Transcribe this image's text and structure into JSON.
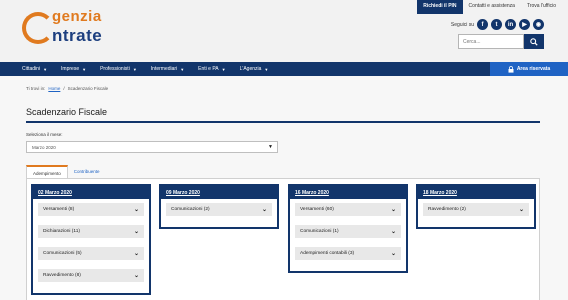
{
  "logo": {
    "line1": "genzia",
    "line2": "ntrate"
  },
  "top_links": [
    "Richiedi il PIN",
    "Contatti e assistenza",
    "Trova l'ufficio"
  ],
  "follow_label": "Seguici su",
  "social": [
    {
      "icon": "facebook-icon",
      "glyph": "f"
    },
    {
      "icon": "twitter-icon",
      "glyph": "t"
    },
    {
      "icon": "linkedin-icon",
      "glyph": "in"
    },
    {
      "icon": "youtube-icon",
      "glyph": "▶"
    },
    {
      "icon": "rss-icon",
      "glyph": "◉"
    }
  ],
  "search": {
    "placeholder": "Cerca..."
  },
  "nav": [
    "Cittadini",
    "Imprese",
    "Professionisti",
    "Intermediari",
    "Enti e PA",
    "L'Agenzia"
  ],
  "reserved": "Area riservata",
  "breadcrumb": {
    "prefix": "Ti trovi in:",
    "home": "Home",
    "sep": "/",
    "current": "Scadenzario Fiscale"
  },
  "page_title": "Scadenzario Fiscale",
  "select": {
    "label": "Seleziona il mese:",
    "value": "Marzo 2020"
  },
  "tabs": [
    "Adempimento",
    "Contribuente"
  ],
  "columns": [
    {
      "date": "02 Marzo 2020",
      "items": [
        "Versamenti (8)",
        "Dichiarazioni (11)",
        "Comunicazioni (5)",
        "Ravvedimento (8)"
      ]
    },
    {
      "date": "09 Marzo 2020",
      "items": [
        "Comunicazioni (2)"
      ]
    },
    {
      "date": "16 Marzo 2020",
      "items": [
        "Versamenti (60)",
        "Comunicazioni (1)",
        "Adempimenti contabili (3)"
      ]
    },
    {
      "date": "18 Marzo 2020",
      "items": [
        "Ravvedimento (2)"
      ]
    }
  ],
  "colors": {
    "navy": "#12356b",
    "orange": "#e07a1f",
    "accent_blue": "#1f63c4"
  }
}
